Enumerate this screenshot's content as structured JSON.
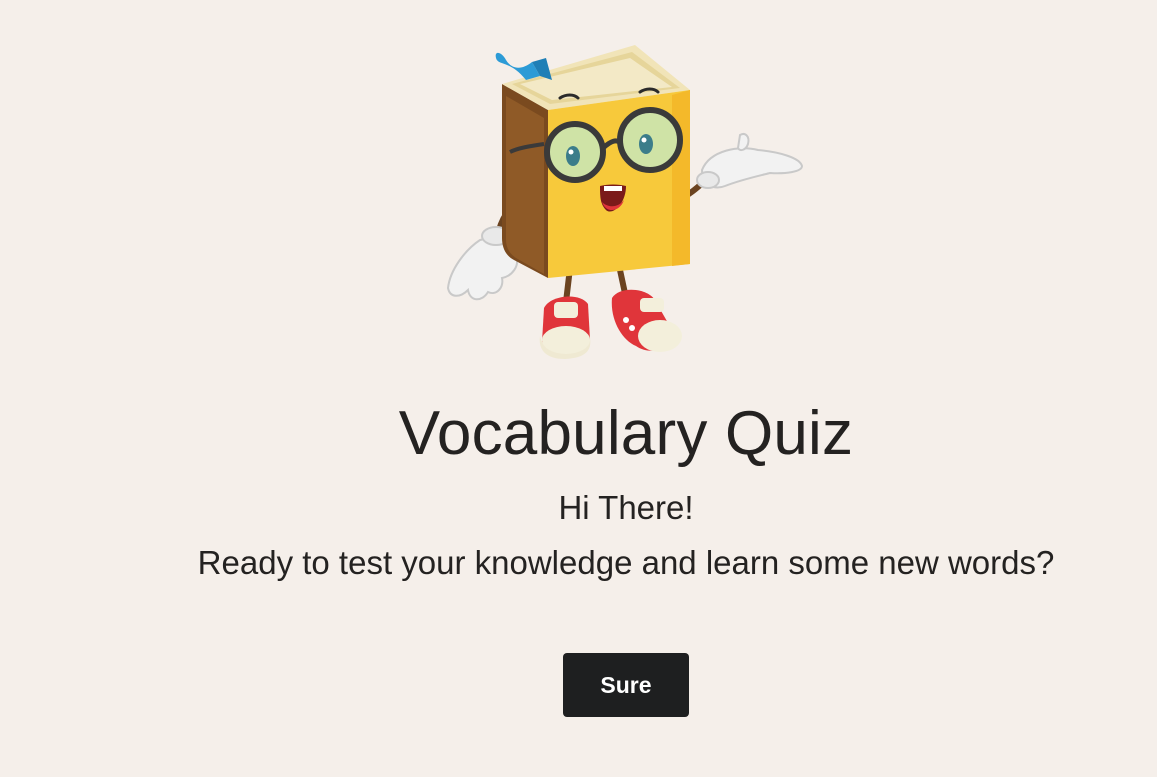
{
  "page": {
    "title": "Vocabulary Quiz",
    "greeting": "Hi There!",
    "prompt": "Ready to test your knowledge and learn some new words?"
  },
  "actions": {
    "start_label": "Sure"
  },
  "mascot": {
    "icon": "book-mascot-icon",
    "description_colors": {
      "cover": "#f7c93b",
      "spine": "#7a4a1f",
      "bookmark": "#2c9bd6",
      "glasses_lens": "#cfe3a6",
      "shoe_red": "#e0353a"
    }
  },
  "colors": {
    "background": "#f5efea",
    "text": "#242221",
    "button_bg": "#1e1f20",
    "button_text": "#ffffff"
  }
}
